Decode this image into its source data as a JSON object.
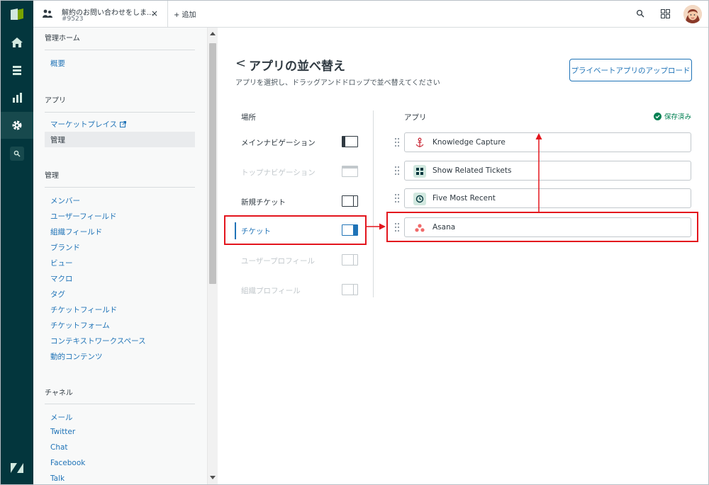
{
  "tab": {
    "title": "解約のお問い合わせをしま...",
    "ticket": "#9523",
    "close": "×"
  },
  "topbar": {
    "add": "+ 追加"
  },
  "sidebar": {
    "sections": [
      {
        "heading": "管理ホーム",
        "links": [
          "概要"
        ]
      },
      {
        "heading": "アプリ",
        "links": [
          "マーケットプレイス",
          "管理"
        ]
      },
      {
        "heading": "管理",
        "links": [
          "メンバー",
          "ユーザーフィールド",
          "組織フィールド",
          "ブランド",
          "ビュー",
          "マクロ",
          "タグ",
          "チケットフィールド",
          "チケットフォーム",
          "コンテキストワークスペース",
          "動的コンテンツ"
        ]
      },
      {
        "heading": "チャネル",
        "links": [
          "メール",
          "Twitter",
          "Chat",
          "Facebook",
          "Talk"
        ]
      }
    ],
    "selected": "管理"
  },
  "main": {
    "back": "<",
    "title": "アプリの並べ替え",
    "subtitle": "アプリを選択し、ドラッグアンドドロップで並べ替えてください",
    "upload_button": "プライベートアプリのアップロード",
    "location_header": "場所",
    "apps_header": "アプリ",
    "saved": "保存済み",
    "locations": [
      {
        "label": "メインナビゲーション",
        "state": "normal"
      },
      {
        "label": "トップナビゲーション",
        "state": "disabled"
      },
      {
        "label": "新規チケット",
        "state": "normal"
      },
      {
        "label": "チケット",
        "state": "active"
      },
      {
        "label": "ユーザープロフィール",
        "state": "disabled"
      },
      {
        "label": "組織プロフィール",
        "state": "disabled"
      }
    ],
    "apps": [
      {
        "name": "Knowledge Capture",
        "icon": "anchor-icon"
      },
      {
        "name": "Show Related Tickets",
        "icon": "grid-icon"
      },
      {
        "name": "Five Most Recent",
        "icon": "clock-icon"
      },
      {
        "name": "Asana",
        "icon": "asana-icon"
      }
    ]
  },
  "colors": {
    "nav": "#03363d",
    "accent": "#1f73b7",
    "highlight": "#e3151d",
    "saved": "#038153"
  }
}
